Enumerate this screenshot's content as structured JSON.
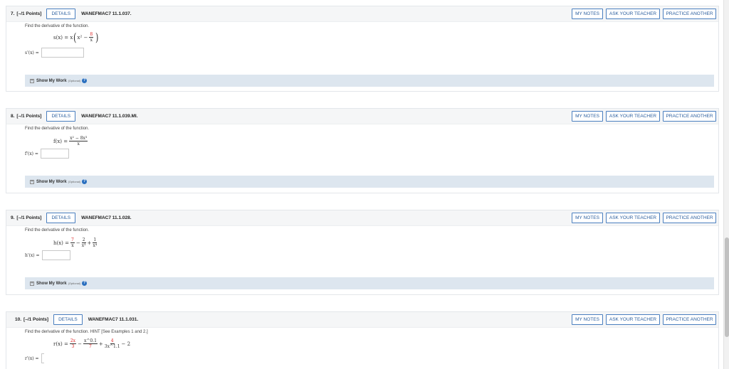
{
  "questions": [
    {
      "number": "7.",
      "points": "[–/1 Points]",
      "details_label": "DETAILS",
      "code": "WANEFMAC7 11.1.037.",
      "prompt": "Find the derivative of the function.",
      "answer_label": "s'(x) =",
      "answer_value": "",
      "show_work_label": "Show My Work",
      "show_work_optional": "(Optional)"
    },
    {
      "number": "8.",
      "points": "[–/1 Points]",
      "details_label": "DETAILS",
      "code": "WANEFMAC7 11.1.039.MI.",
      "prompt": "Find the derivative of the function.",
      "answer_label": "f'(x) =",
      "answer_value": "",
      "show_work_label": "Show My Work",
      "show_work_optional": "(Optional)"
    },
    {
      "number": "9.",
      "points": "[–/1 Points]",
      "details_label": "DETAILS",
      "code": "WANEFMAC7 11.1.028.",
      "prompt": "Find the derivative of the function.",
      "answer_label": "h'(x) =",
      "answer_value": "",
      "show_work_label": "Show My Work",
      "show_work_optional": "(Optional)"
    },
    {
      "number": "10.",
      "points": "[–/1 Points]",
      "details_label": "DETAILS",
      "code": "WANEFMAC7 11.1.031.",
      "prompt": "Find the derivative of the function. HINT [See Examples 1 and 2.]",
      "answer_label": "r'(x) =",
      "answer_value": ""
    }
  ],
  "buttons": {
    "my_notes": "MY NOTES",
    "ask_teacher": "ASK YOUR TEACHER",
    "practice_another": "PRACTICE ANOTHER"
  },
  "formulas": {
    "q7": {
      "lhs": "s(x) = x",
      "inner": "x² −",
      "frac_num": "8",
      "frac_den": "x"
    },
    "q8": {
      "lhs": "f(x) =",
      "frac_num": "x² − 8x³",
      "frac_den": "x"
    },
    "q9": {
      "lhs": "h(x) =",
      "f1_num": "7",
      "f1_den": "x",
      "op1": "−",
      "f2_num": "2",
      "f2_den": "x³",
      "op2": "+",
      "f3_num": "1",
      "f3_den": "x⁴"
    },
    "q10": {
      "lhs": "r(x) =",
      "f1_num": "2x",
      "f1_den": "3",
      "op1": "−",
      "f2_num": "x^0.1",
      "f2_den": "7",
      "op2": "+",
      "f3_num": "4",
      "f3_den": "3x^1.1",
      "tail": "− 2"
    }
  },
  "colors": {
    "accent": "#2a5e9e",
    "work_bar": "#dde6ef",
    "header_bg": "#f5f6f7"
  }
}
